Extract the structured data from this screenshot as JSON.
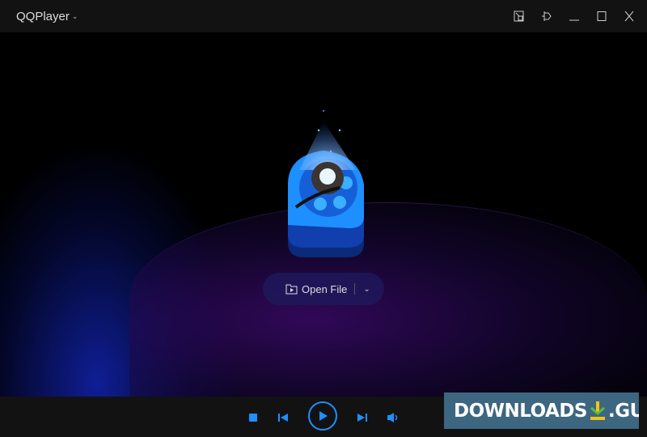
{
  "titlebar": {
    "app_name": "QQPlayer"
  },
  "main": {
    "open_file_label": "Open File"
  },
  "watermark": {
    "left": "DOWNLOADS",
    "right": ".GURU"
  },
  "colors": {
    "accent": "#1e8fff",
    "titlebar": "#121212"
  }
}
